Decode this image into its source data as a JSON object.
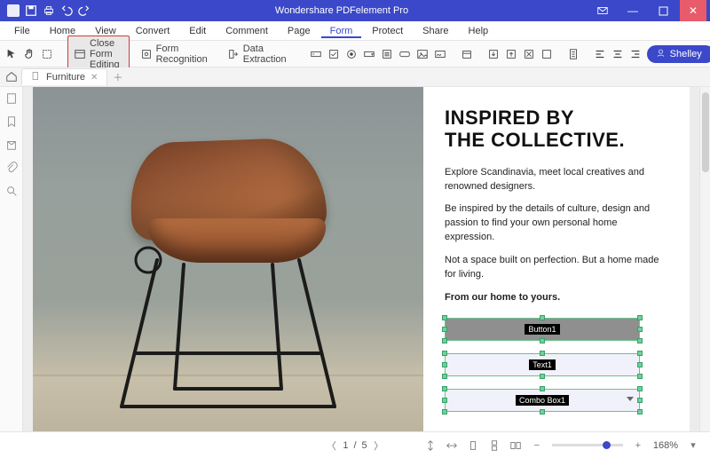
{
  "app": {
    "title": "Wondershare PDFelement Pro"
  },
  "menu": {
    "items": [
      "File",
      "Home",
      "View",
      "Convert",
      "Edit",
      "Comment",
      "Page",
      "Form",
      "Protect",
      "Share",
      "Help"
    ],
    "active": "Form"
  },
  "toolbar": {
    "close_form_editing": "Close Form Editing",
    "form_recognition": "Form Recognition",
    "data_extraction": "Data Extraction",
    "user_label": "Shelley"
  },
  "tab": {
    "name": "Furniture"
  },
  "document": {
    "heading_line1": "INSPIRED BY",
    "heading_line2": "THE COLLECTIVE.",
    "p1": "Explore Scandinavia, meet local creatives and renowned designers.",
    "p2": "Be inspired by the details of culture, design and passion to find your own personal home expression.",
    "p3": "Not a space built on perfection. But a home made for living.",
    "p4": "From our home to yours.",
    "fields": {
      "button_label": "Button1",
      "text_label": "Text1",
      "combo_label": "Combo Box1"
    }
  },
  "status": {
    "page_current": "1",
    "page_total": "5",
    "zoom": "168%"
  }
}
